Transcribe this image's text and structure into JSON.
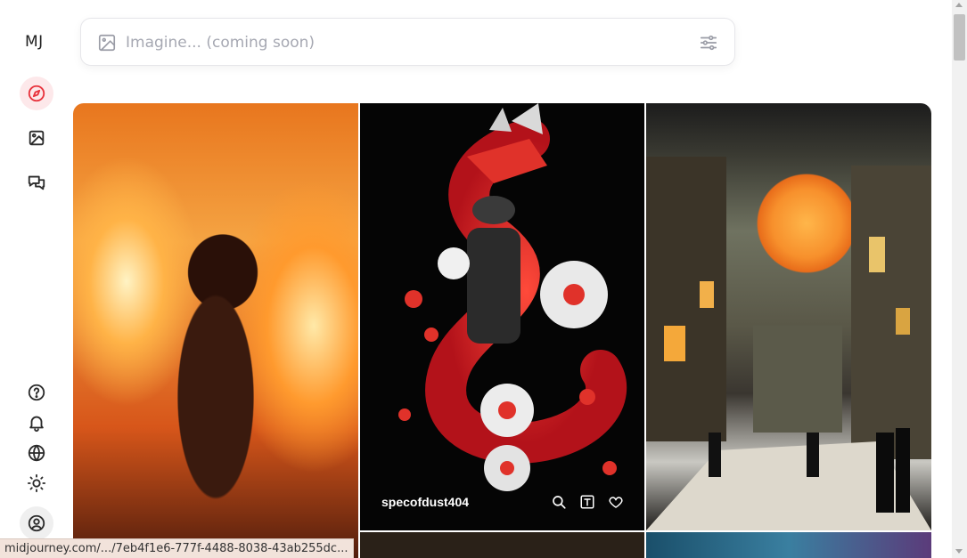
{
  "sidebar": {
    "logo": "MJ",
    "nav": [
      {
        "icon": "compass-icon",
        "label": "Explore",
        "active": true
      },
      {
        "icon": "image-icon",
        "label": "Create"
      },
      {
        "icon": "chat-icon",
        "label": "Chat"
      }
    ],
    "bottom": [
      {
        "icon": "help-icon"
      },
      {
        "icon": "bell-icon"
      },
      {
        "icon": "globe-icon"
      },
      {
        "icon": "sun-icon"
      },
      {
        "icon": "profile-icon"
      }
    ]
  },
  "search": {
    "placeholder": "Imagine... (coming soon)",
    "value": ""
  },
  "gallery": {
    "hover_tile": {
      "author": "specofdust404",
      "actions": [
        "search-icon",
        "text-prompt-icon",
        "heart-icon"
      ]
    }
  },
  "status_bar": {
    "url": "midjourney.com/.../7eb4f1e6-777f-4488-8038-43ab255dc..."
  },
  "colors": {
    "accent": "#e8323c",
    "active_bg": "#fde8ea",
    "icon": "#2b2b2b"
  }
}
